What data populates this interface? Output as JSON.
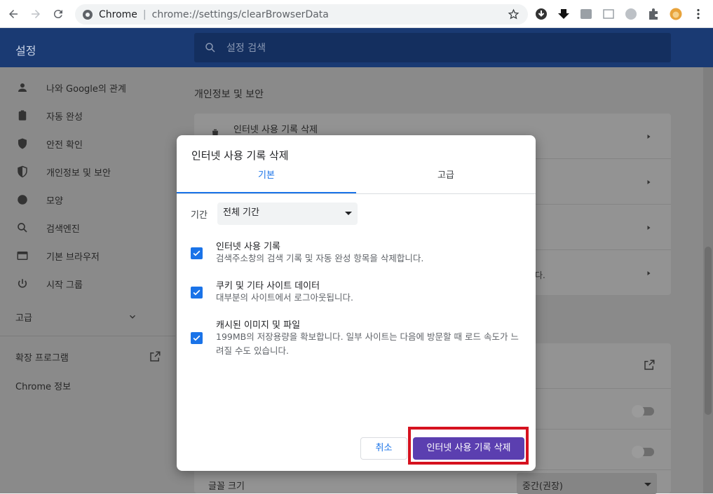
{
  "browser": {
    "site_name": "Chrome",
    "url": "chrome://settings/clearBrowserData"
  },
  "settings": {
    "title": "설정",
    "search_placeholder": "설정 검색",
    "sidebar": {
      "items": [
        {
          "label": "나와 Google의 관계",
          "icon": "person-icon"
        },
        {
          "label": "자동 완성",
          "icon": "clipboard-icon"
        },
        {
          "label": "안전 확인",
          "icon": "shield-check-icon"
        },
        {
          "label": "개인정보 및 보안",
          "icon": "shield-half-icon"
        },
        {
          "label": "모양",
          "icon": "palette-icon"
        },
        {
          "label": "검색엔진",
          "icon": "search-icon"
        },
        {
          "label": "기본 브라우저",
          "icon": "browser-icon"
        },
        {
          "label": "시작 그룹",
          "icon": "power-icon"
        }
      ],
      "advanced_label": "고급",
      "extensions_label": "확장 프로그램",
      "about_label": "Chrome 정보"
    },
    "main": {
      "section_title": "개인정보 및 보안",
      "first_row_label": "인터넷 사용 기록 삭제",
      "partial_text": "다.",
      "font_size_label": "글꼴 크기",
      "font_size_value": "중간(권장)"
    }
  },
  "dialog": {
    "title": "인터넷 사용 기록 삭제",
    "tabs": [
      {
        "label": "기본",
        "active": true
      },
      {
        "label": "고급",
        "active": false
      }
    ],
    "range_label": "기간",
    "range_value": "전체 기간",
    "options": [
      {
        "title": "인터넷 사용 기록",
        "desc": "검색주소창의 검색 기록 및 자동 완성 항목을 삭제합니다.",
        "checked": true
      },
      {
        "title": "쿠키 및 기타 사이트 데이터",
        "desc": "대부분의 사이트에서 로그아웃됩니다.",
        "checked": true
      },
      {
        "title": "캐시된 이미지 및 파일",
        "desc": "199MB의 저장용량을 확보합니다. 일부 사이트는 다음에 방문할 때 로드 속도가 느려질 수도 있습니다.",
        "checked": true
      }
    ],
    "cancel_label": "취소",
    "confirm_label": "인터넷 사용 기록 삭제"
  },
  "colors": {
    "accent": "#1a73e8",
    "confirm_button": "#5b3fb0",
    "highlight": "#d6121f",
    "header": "#1a3a73"
  }
}
